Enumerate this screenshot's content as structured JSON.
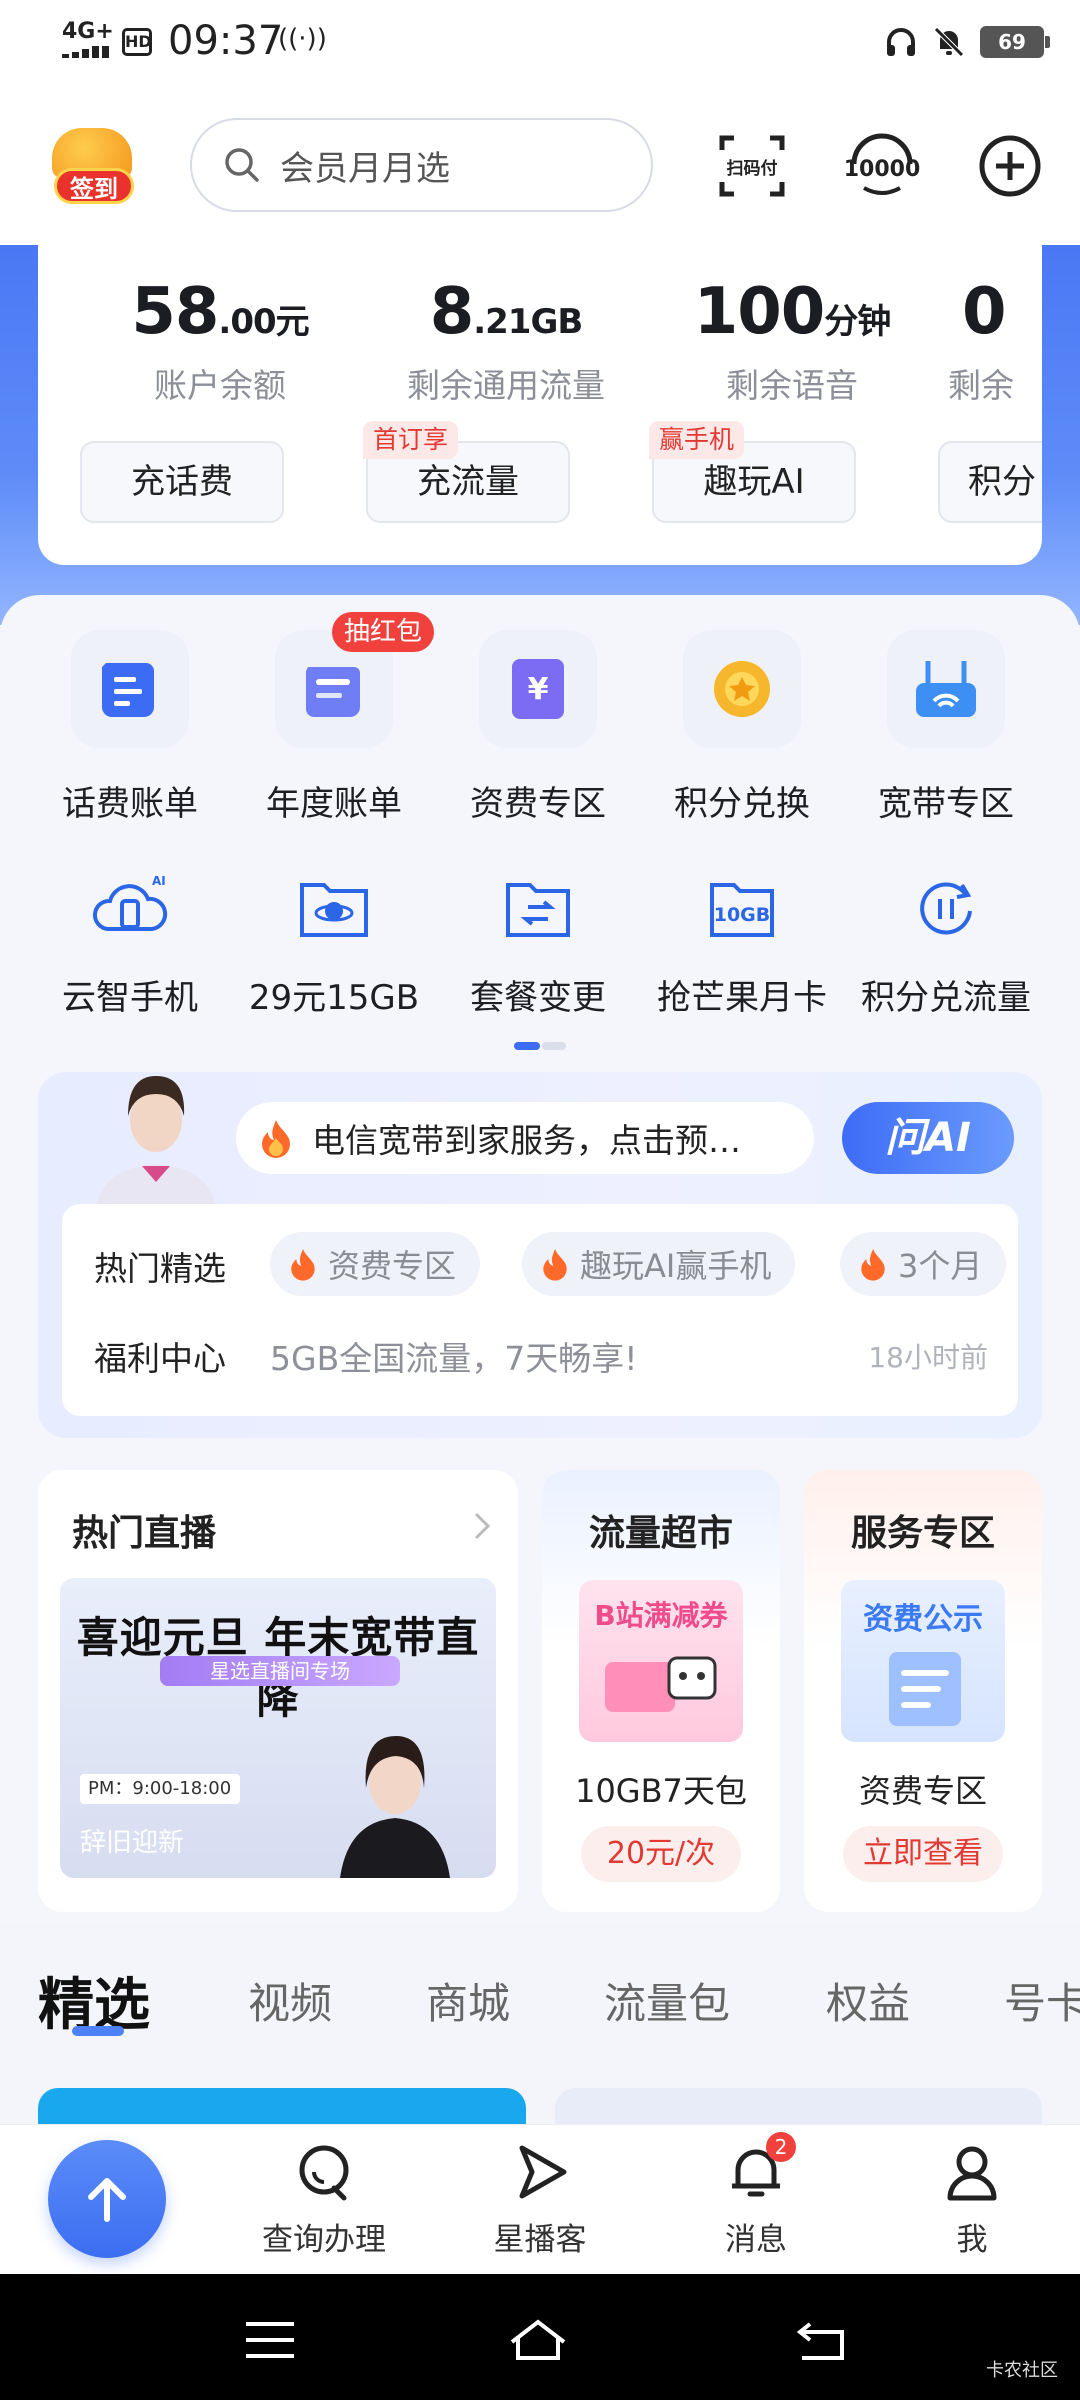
{
  "status_bar": {
    "network": "4G+",
    "hd": "HD",
    "time": "09:37",
    "battery": "69"
  },
  "header": {
    "signin_label": "签到",
    "search_placeholder": "会员月月选",
    "scan_pay_label": "扫码付",
    "hotline_label": "10000"
  },
  "balance": {
    "items": [
      {
        "value": "58",
        "decimal": ".00",
        "unit": "元",
        "label": "账户余额",
        "button": "充话费",
        "tag": ""
      },
      {
        "value": "8",
        "decimal": ".21",
        "unit": "GB",
        "label": "剩余通用流量",
        "button": "充流量",
        "tag": "首订享"
      },
      {
        "value": "100",
        "decimal": "",
        "unit": "分钟",
        "label": "剩余语音",
        "button": "趣玩AI",
        "tag": "赢手机"
      },
      {
        "value": "0",
        "decimal": "",
        "unit": "",
        "label": "剩余",
        "button": "积分",
        "tag": ""
      }
    ]
  },
  "services_row1": [
    {
      "label": "话费账单",
      "icon": "bill-icon"
    },
    {
      "label": "年度账单",
      "icon": "annual-bill-icon",
      "badge": "抽红包"
    },
    {
      "label": "资费专区",
      "icon": "tariff-icon"
    },
    {
      "label": "积分兑换",
      "icon": "points-exchange-icon"
    },
    {
      "label": "宽带专区",
      "icon": "broadband-icon"
    }
  ],
  "services_row2": [
    {
      "label": "云智手机",
      "icon": "cloud-phone-icon"
    },
    {
      "label": "29元15GB",
      "icon": "planet-folder-icon"
    },
    {
      "label": "套餐变更",
      "icon": "plan-change-icon"
    },
    {
      "label": "抢芒果月卡",
      "icon": "10gb-icon"
    },
    {
      "label": "积分兑流量",
      "icon": "points-to-data-icon"
    }
  ],
  "ai_card": {
    "bubble_text": "电信宽带到家服务，点击预…",
    "ask_ai": "问AI",
    "hot_label": "热门精选",
    "chips": [
      "资费专区",
      "趣玩AI赢手机",
      "3个月"
    ],
    "welfare_label": "福利中心",
    "welfare_text": "5GB全国流量，7天畅享!",
    "welfare_time": "18小时前"
  },
  "cards": {
    "live": {
      "title": "热门直播",
      "headline": "喜迎元旦 年末宽带直降",
      "sub": "星选直播间专场",
      "time": "PM：9:00-18:00",
      "caption": "辞旧迎新"
    },
    "data_market": {
      "title": "流量超市",
      "pic_text": "B站满减券",
      "label": "10GB7天包",
      "button": "20元/次"
    },
    "service": {
      "title": "服务专区",
      "pic_text": "资费公示",
      "label": "资费专区",
      "button": "立即查看"
    }
  },
  "tabs": [
    "精选",
    "视频",
    "商城",
    "流量包",
    "权益",
    "号卡"
  ],
  "bottom_nav": [
    {
      "label": "查询办理",
      "icon": "search-icon"
    },
    {
      "label": "星播客",
      "icon": "play-icon"
    },
    {
      "label": "消息",
      "icon": "bell-icon",
      "badge": "2"
    },
    {
      "label": "我",
      "icon": "user-icon"
    }
  ],
  "watermark": "卡农社区"
}
